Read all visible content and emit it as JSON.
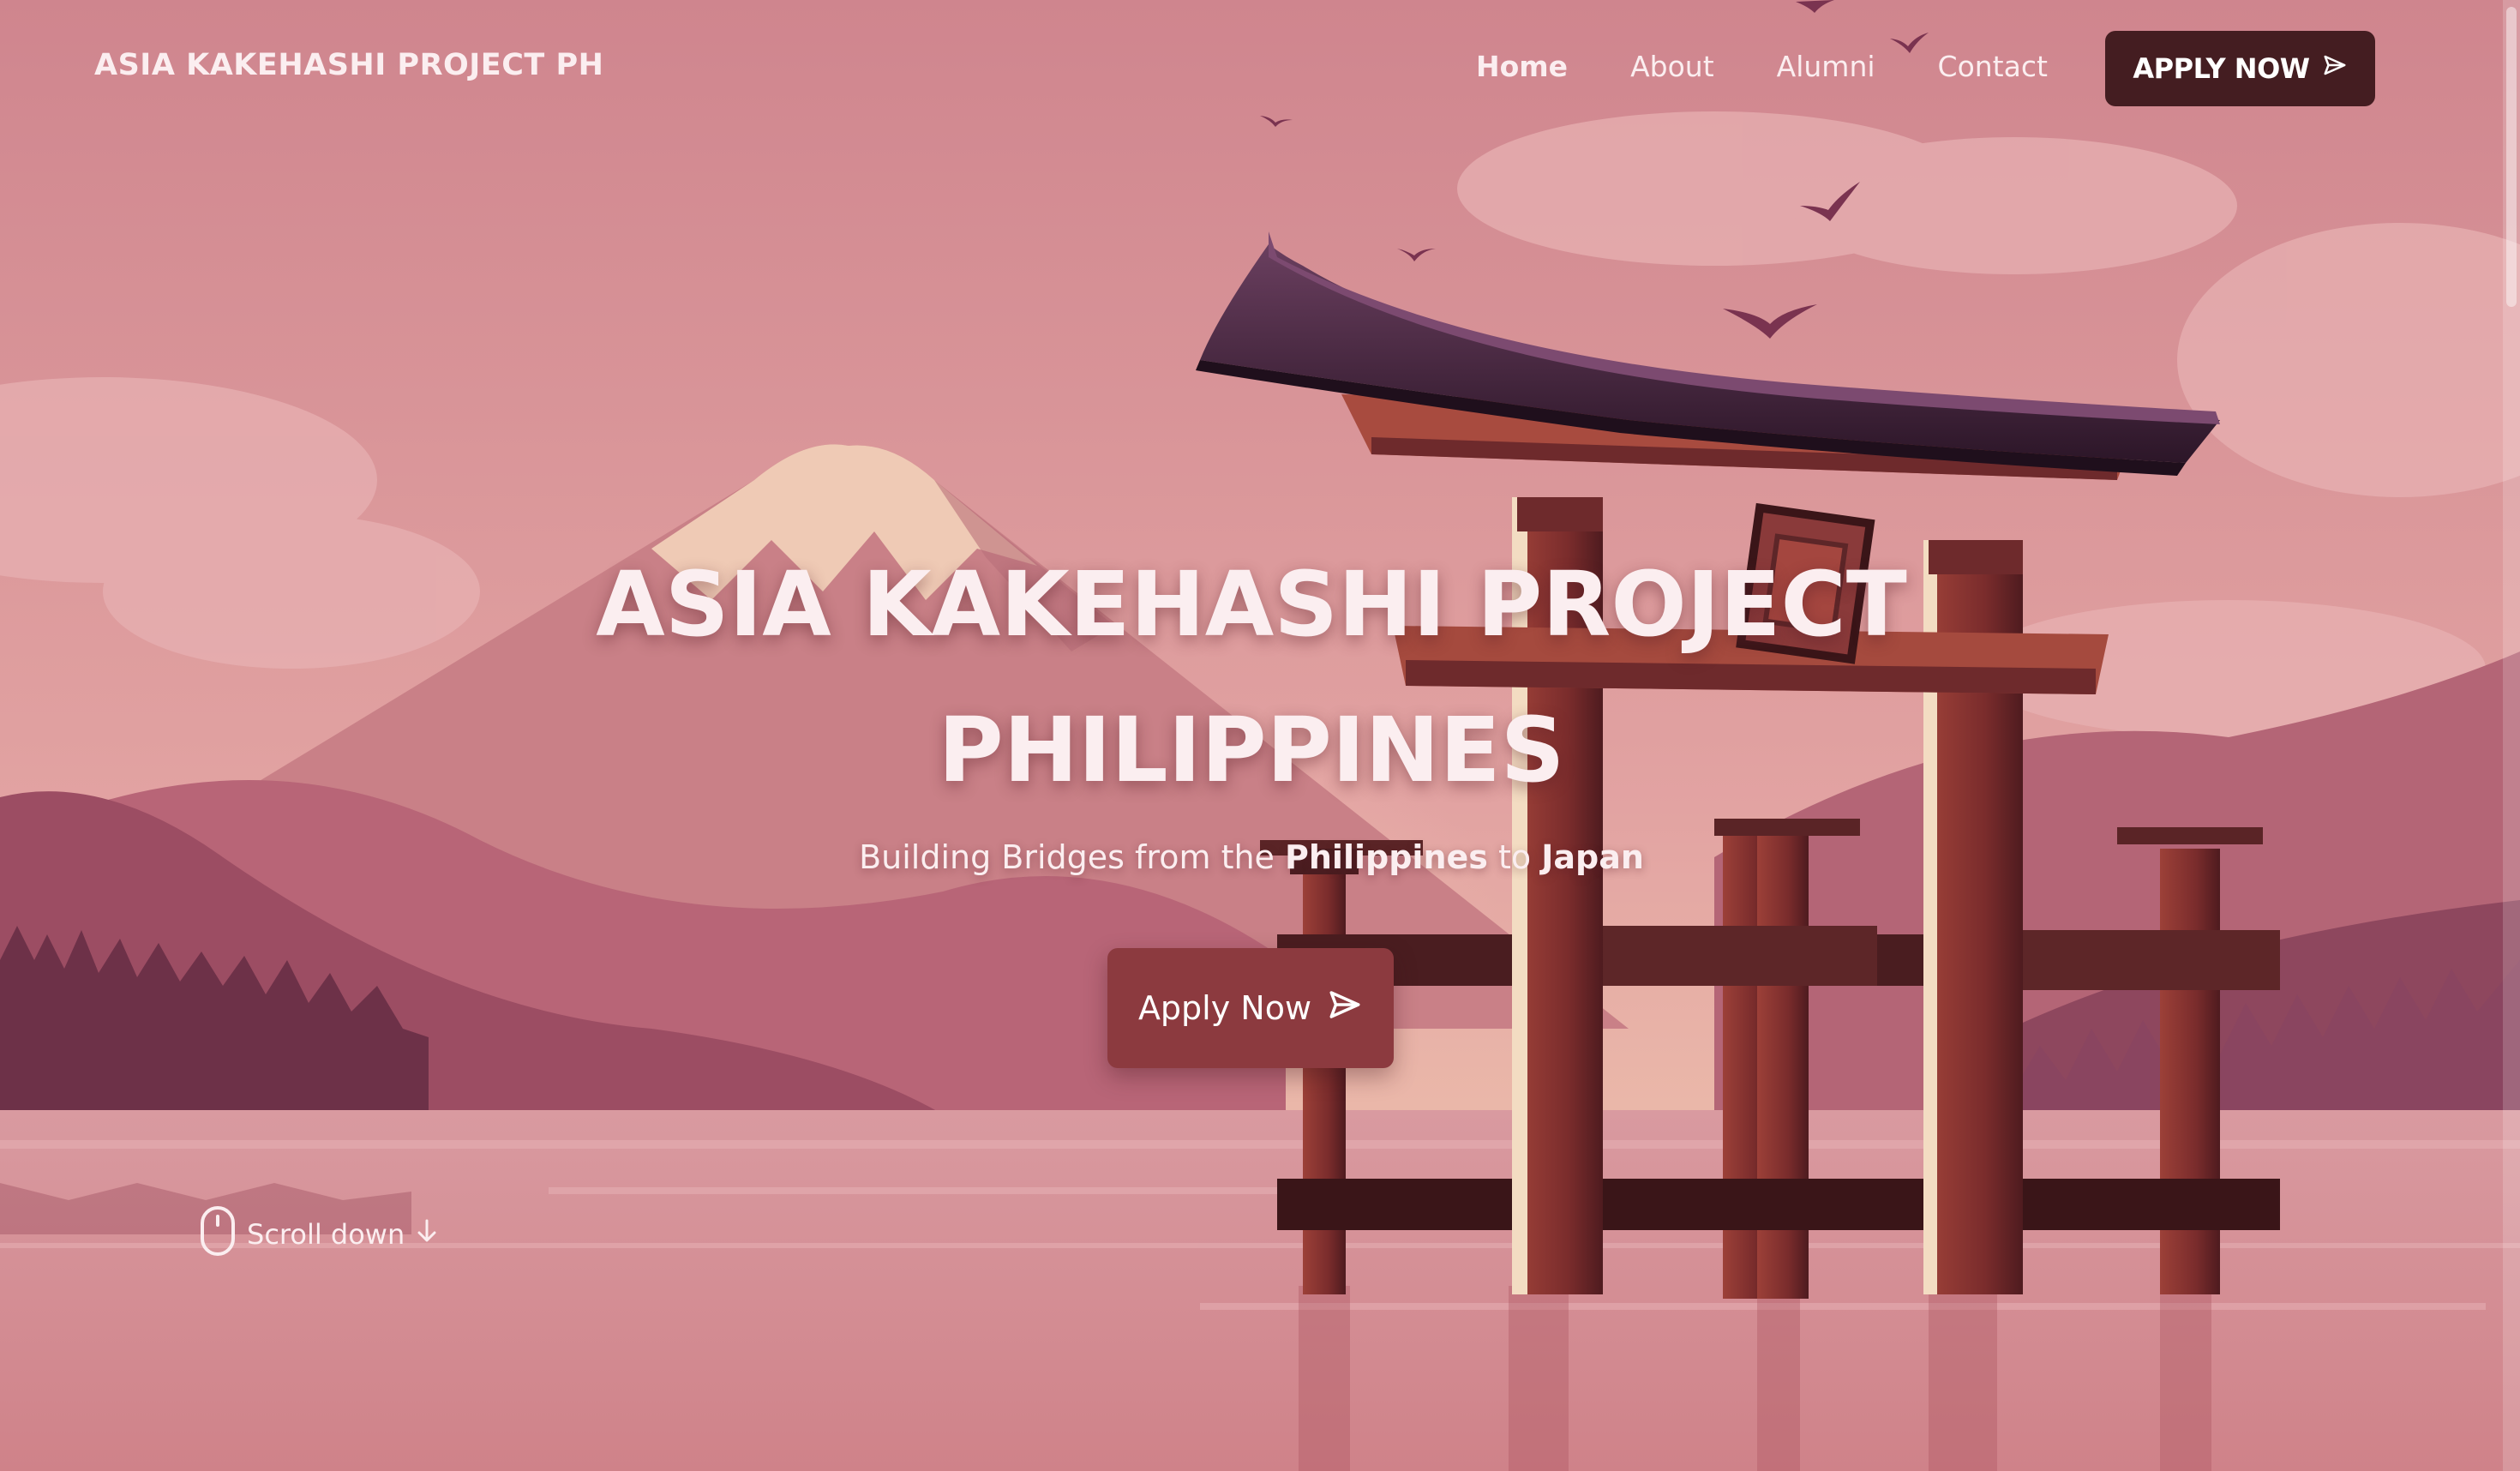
{
  "nav": {
    "brand": "ASIA KAKEHASHI PROJECT PH",
    "links": [
      {
        "label": "Home",
        "active": true
      },
      {
        "label": "About",
        "active": false
      },
      {
        "label": "Alumni",
        "active": false
      },
      {
        "label": "Contact",
        "active": false
      }
    ],
    "cta_label": "APPLY NOW",
    "cta_icon": "send-icon"
  },
  "hero": {
    "title_line1": "ASIA KAKEHASHI PROJECT",
    "title_line2": "PHILIPPINES",
    "subtitle_prefix": "Building Bridges from the",
    "subtitle_country1": "Philippines",
    "subtitle_mid": "to",
    "subtitle_country2": "Japan",
    "cta_label": "Apply Now",
    "cta_icon": "send-icon",
    "scroll_label": "Scroll down",
    "scroll_icons": [
      "mouse-icon",
      "arrow-down-icon"
    ]
  },
  "colors": {
    "sky": "#d2878f",
    "nav_button": "#441d21",
    "hero_button": "#8c3a3f",
    "text_light": "#fbeef0",
    "torii": "#8b3434",
    "roof": "#4a2a44"
  }
}
